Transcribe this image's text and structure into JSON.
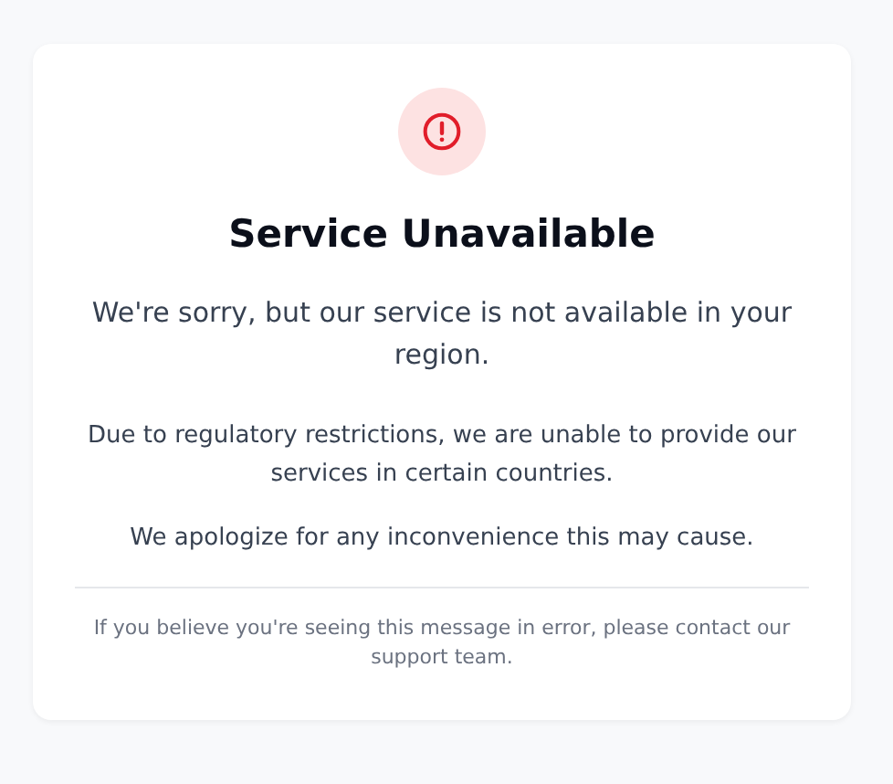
{
  "title": "Service Unavailable",
  "subtitle": "We're sorry, but our service is not available in your region.",
  "paragraphs": [
    "Due to regulatory restrictions, we are unable to provide our services in certain countries.",
    "We apologize for any inconvenience this may cause."
  ],
  "footer": "If you believe you're seeing this message in error, please contact our support team."
}
